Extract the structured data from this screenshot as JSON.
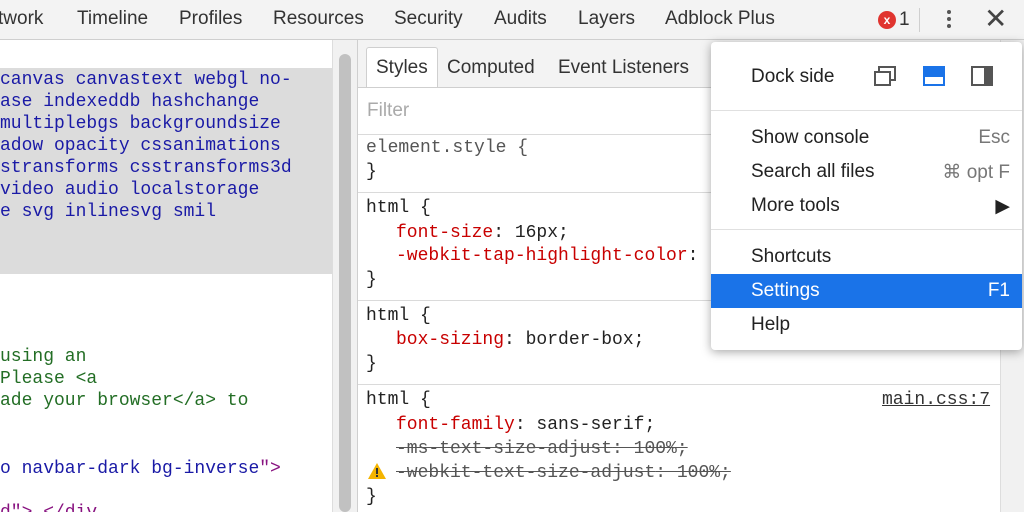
{
  "top_tabs": [
    "twork",
    "Timeline",
    "Profiles",
    "Resources",
    "Security",
    "Audits",
    "Layers",
    "Adblock Plus"
  ],
  "error_badge": {
    "icon": "x",
    "count": "1",
    "color": "#e0342f"
  },
  "left_code": {
    "class_lines": [
      "canvas canvastext webgl no-",
      "ase indexeddb hashchange",
      "multiplebgs backgroundsize",
      "adow opacity cssanimations",
      "stransforms csstransforms3d",
      "video audio localstorage",
      "e svg inlinesvg smil"
    ],
    "comment_lines": [
      "using an",
      "Please <a",
      "ade your browser</a> to"
    ],
    "navbar_line": {
      "prefix": "o navbar-dark bg-inverse",
      "suffix": "\">"
    },
    "partial_line": "d\"> </div"
  },
  "sub_tabs": [
    "Styles",
    "Computed",
    "Event Listeners"
  ],
  "filter_placeholder": "Filter",
  "rules": {
    "element_style": {
      "selector": "element.style {",
      "close": "}"
    },
    "html1": {
      "selector": "html {",
      "decls": [
        {
          "prop": "font-size",
          "value": " 16px;"
        },
        {
          "prop": "-webkit-tap-highlight-color",
          "value": ":"
        }
      ],
      "close": "}"
    },
    "html2": {
      "selector": "html {",
      "decls": [
        {
          "prop": "box-sizing",
          "value": ": border-box;"
        }
      ],
      "close": "}"
    },
    "html3": {
      "selector": "html {",
      "source": "main.css:7",
      "decls": [
        {
          "prop": "font-family",
          "value": ": sans-serif;"
        },
        {
          "prop": "-ms-text-size-adjust",
          "value": ": 100%;"
        },
        {
          "prop": "-webkit-text-size-adjust",
          "value": ": 100%;"
        }
      ],
      "close": "}"
    }
  },
  "menu": {
    "dock_side_label": "Dock side",
    "items": [
      {
        "label": "Show console",
        "shortcut": "Esc"
      },
      {
        "label": "Search all files",
        "shortcut": "⌘ opt F"
      },
      {
        "label": "More tools",
        "shortcut": "▶"
      },
      {
        "label": "Shortcuts",
        "shortcut": ""
      },
      {
        "label": "Settings",
        "shortcut": "F1"
      },
      {
        "label": "Help",
        "shortcut": ""
      }
    ],
    "accent_color": "#1a73e8"
  }
}
